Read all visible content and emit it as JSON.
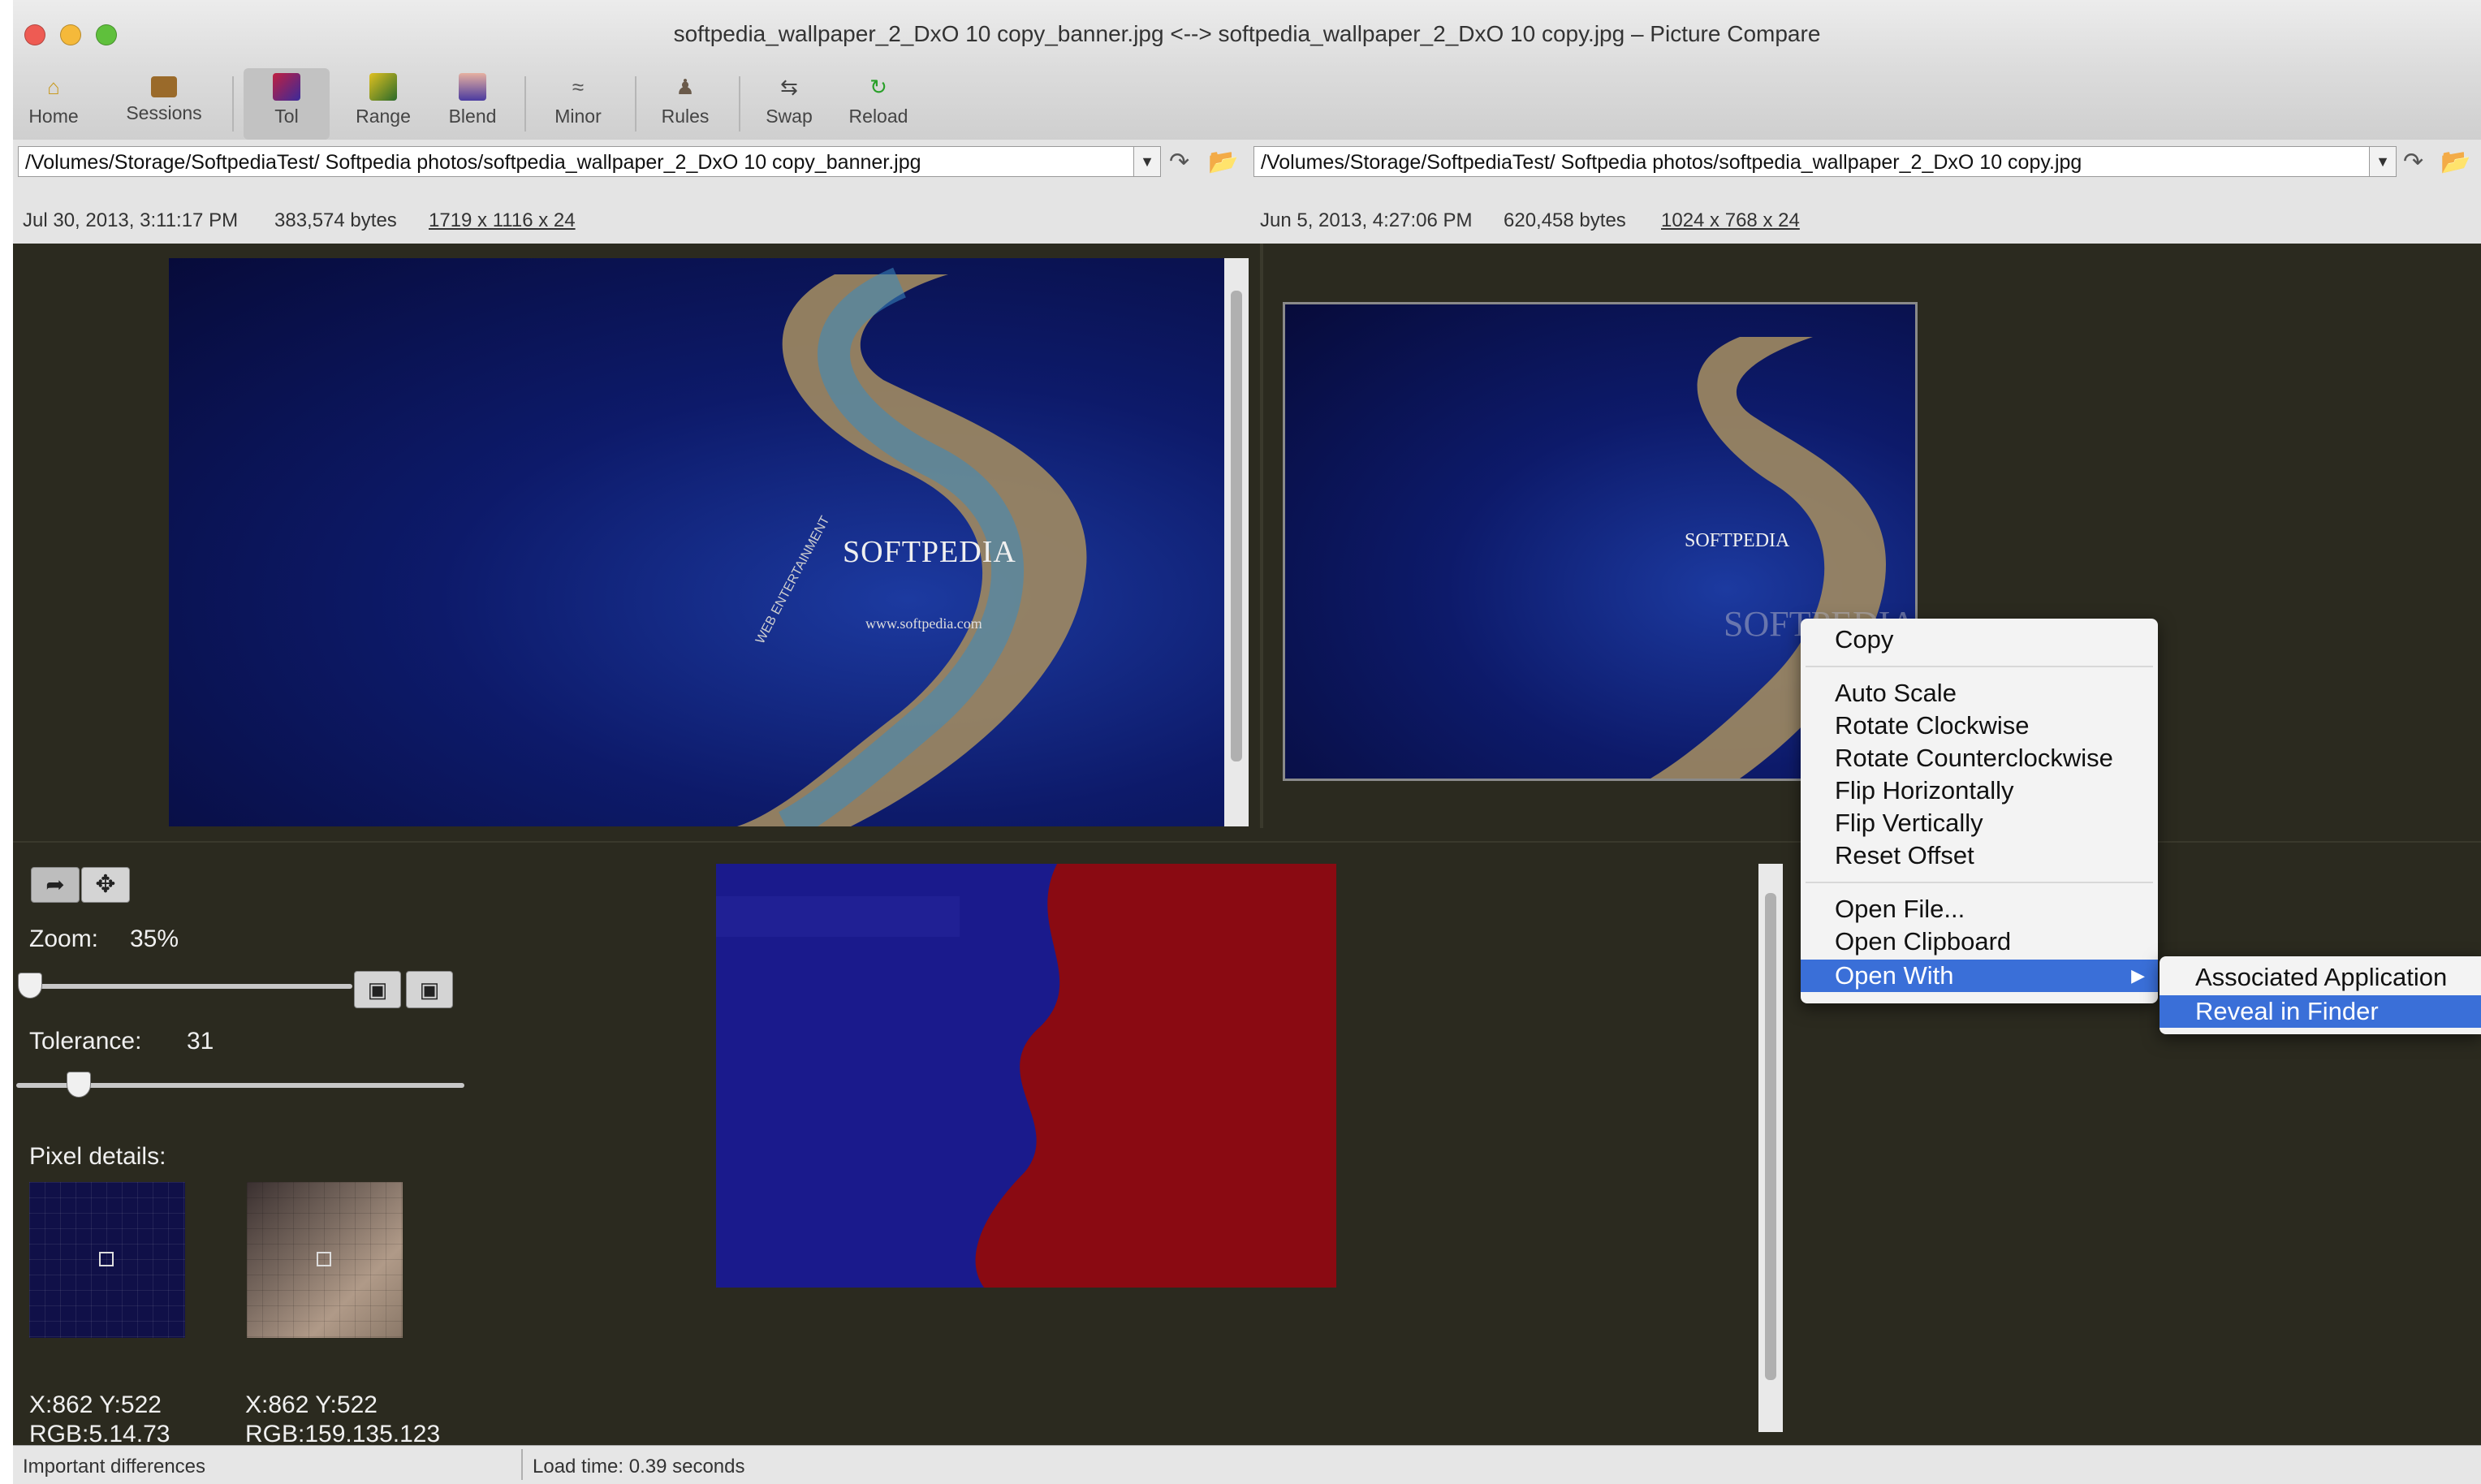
{
  "window": {
    "title": "softpedia_wallpaper_2_DxO 10 copy_banner.jpg <--> softpedia_wallpaper_2_DxO 10 copy.jpg – Picture Compare"
  },
  "toolbar": {
    "home": "Home",
    "sessions": "Sessions",
    "tol": "Tol",
    "range": "Range",
    "blend": "Blend",
    "minor": "Minor",
    "rules": "Rules",
    "swap": "Swap",
    "reload": "Reload"
  },
  "left_file": {
    "path": "/Volumes/Storage/SoftpediaTest/ Softpedia photos/softpedia_wallpaper_2_DxO 10 copy_banner.jpg",
    "date": "Jul 30, 2013, 3:11:17 PM",
    "size": "383,574 bytes",
    "dims": "1719 x 1116 x 24"
  },
  "right_file": {
    "path": "/Volumes/Storage/SoftpediaTest/ Softpedia photos/softpedia_wallpaper_2_DxO 10 copy.jpg",
    "date": "Jun 5, 2013, 4:27:06 PM",
    "size": "620,458 bytes",
    "dims": "1024 x 768 x 24"
  },
  "image_text": {
    "brand": "SOFTPEDIA",
    "url": "www.softpedia.com",
    "web": "WEB ENTERTAINMENT",
    "ghost": "SOFTPEDIA"
  },
  "controls": {
    "zoom_label": "Zoom:",
    "zoom_value": "35%",
    "zoom_level": 0,
    "tolerance_label": "Tolerance:",
    "tolerance_value": "31",
    "pixel_details_label": "Pixel details:",
    "left_coords": "X:862 Y:522",
    "left_rgb": "RGB:5.14.73",
    "right_coords": "X:862 Y:522",
    "right_rgb": "RGB:159.135.123"
  },
  "context_menu": {
    "items": [
      "Copy",
      "Auto Scale",
      "Rotate Clockwise",
      "Rotate Counterclockwise",
      "Flip Horizontally",
      "Flip Vertically",
      "Reset Offset",
      "Open File...",
      "Open Clipboard",
      "Open With"
    ],
    "submenu": [
      "Associated Application",
      "Reveal in Finder"
    ]
  },
  "status": {
    "left": "Important differences",
    "right": "Load time: 0.39 seconds"
  },
  "colors": {
    "background": "#2b2a1f",
    "selection": "#3a6fd8",
    "diff_red": "#8a0a12",
    "diff_blue": "#1a1a8c"
  }
}
